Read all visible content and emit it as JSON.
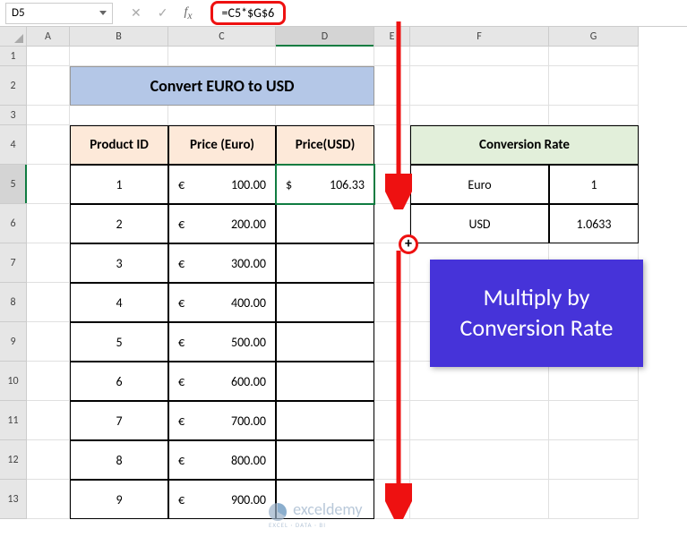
{
  "nameBox": "D5",
  "formula": "=C5*$G$6",
  "columns": [
    "A",
    "B",
    "C",
    "D",
    "E",
    "F",
    "G"
  ],
  "rows": [
    "1",
    "2",
    "3",
    "4",
    "5",
    "6",
    "7",
    "8",
    "9",
    "10",
    "11",
    "12",
    "13"
  ],
  "title": "Convert EURO to USD",
  "headers": {
    "b": "Product ID",
    "c": "Price (Euro)",
    "d": "Price(USD)"
  },
  "products": [
    {
      "id": "1",
      "euro": "100.00",
      "usd": "106.33"
    },
    {
      "id": "2",
      "euro": "200.00",
      "usd": ""
    },
    {
      "id": "3",
      "euro": "300.00",
      "usd": ""
    },
    {
      "id": "4",
      "euro": "400.00",
      "usd": ""
    },
    {
      "id": "5",
      "euro": "500.00",
      "usd": ""
    },
    {
      "id": "6",
      "euro": "600.00",
      "usd": ""
    },
    {
      "id": "7",
      "euro": "700.00",
      "usd": ""
    },
    {
      "id": "8",
      "euro": "800.00",
      "usd": ""
    },
    {
      "id": "9",
      "euro": "900.00",
      "usd": ""
    }
  ],
  "conv": {
    "header": "Conversion Rate",
    "rows": [
      {
        "label": "Euro",
        "val": "1"
      },
      {
        "label": "USD",
        "val": "1.0633"
      }
    ]
  },
  "callout": "Multiply by Conversion Rate",
  "euroSym": "€",
  "usdSym": "$",
  "watermark": "exceldemy",
  "watermark_sub": "EXCEL · DATA · BI"
}
